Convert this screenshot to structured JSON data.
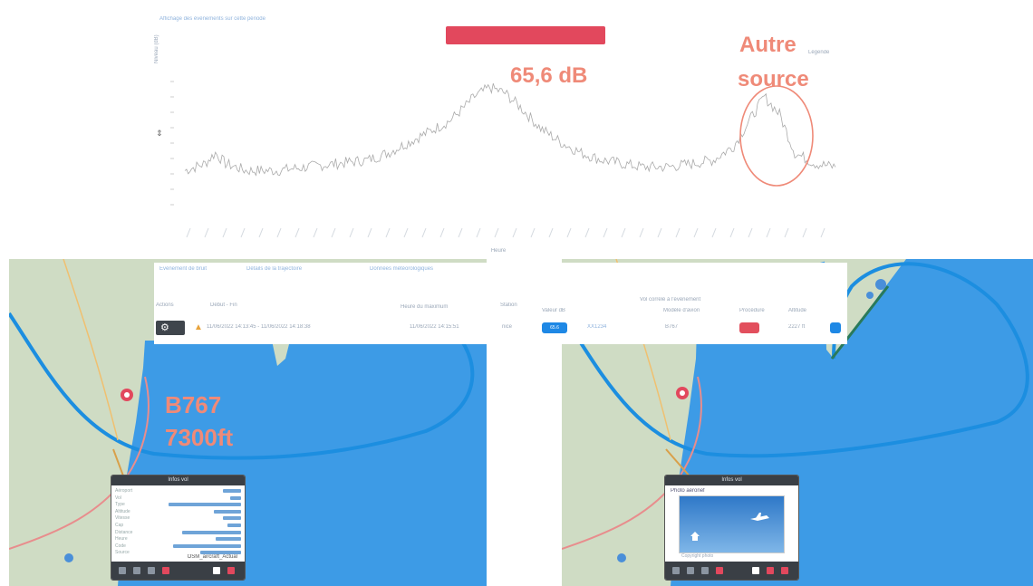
{
  "chart": {
    "top_link": "Affichage des évènements sur cette période",
    "red_banner": "",
    "y_axis_label": "Niveau (dB)",
    "annotation_level": "65,6 dB",
    "annotation_source": [
      "Autre",
      "source"
    ],
    "corner_text": "Légende",
    "x_axis_label": "Heure"
  },
  "chart_data": {
    "type": "line",
    "title": "",
    "ylabel": "",
    "xlabel": "",
    "peak_annotation": "65,6 dB",
    "highlight_annotation": "Autre source",
    "series": [
      {
        "color": "#aaaaaa",
        "points": [
          [
            0,
            42
          ],
          [
            4,
            44
          ],
          [
            6,
            47
          ],
          [
            8,
            44
          ],
          [
            12,
            42
          ],
          [
            18,
            42
          ],
          [
            24,
            43
          ],
          [
            30,
            44
          ],
          [
            36,
            45
          ],
          [
            40,
            47
          ],
          [
            44,
            50
          ],
          [
            48,
            53
          ],
          [
            52,
            56
          ],
          [
            55,
            60
          ],
          [
            57,
            63
          ],
          [
            60,
            65.6
          ],
          [
            63,
            64
          ],
          [
            66,
            60
          ],
          [
            70,
            54
          ],
          [
            74,
            50
          ],
          [
            78,
            47
          ],
          [
            82,
            45
          ],
          [
            86,
            44
          ],
          [
            90,
            43
          ],
          [
            95,
            43
          ],
          [
            100,
            44
          ],
          [
            104,
            45
          ],
          [
            108,
            49
          ],
          [
            111,
            56
          ],
          [
            114,
            63
          ],
          [
            117,
            58
          ],
          [
            120,
            47
          ],
          [
            124,
            44
          ],
          [
            128,
            43
          ]
        ]
      }
    ]
  },
  "tabs": {
    "items": [
      "Évènement de bruit",
      "Détails de la trajectoire",
      "Données météorologiques"
    ]
  },
  "table": {
    "headers": [
      "Actions",
      "Début - Fin",
      "Heure du maximum",
      "Station",
      "Valeur dB",
      "Vol corrélé à l'évènement",
      "Modèle d'avion",
      "Procédure",
      "Altitude"
    ],
    "row": {
      "period": "11/06/2022 14:13:45 - 11/06/2022 14:18:38",
      "max_time": "11/06/2022 14:15:51",
      "station": "nice",
      "db_value": "65.6",
      "flight": "XX1234",
      "model": "B767",
      "procedure": "",
      "altitude": "2227 ft"
    }
  },
  "left_map": {
    "annotation": [
      "B767",
      "7300ft"
    ],
    "popup_title": "Infos vol",
    "popup_rows": [
      "Aéroport",
      "Vol",
      "Type",
      "Altitude",
      "Vitesse",
      "Cap",
      "Distance",
      "Heure",
      "Code",
      "Source"
    ],
    "popup_values": [
      0.2,
      0.12,
      0.8,
      0.3,
      0.2,
      0.15,
      0.65,
      0.28,
      0.75,
      0.45
    ],
    "footer_label": "OSM_aircraft_Actual"
  },
  "right_map": {
    "popup_title": "Infos vol",
    "popup_caption": "Photo aéronef",
    "photo_credit": "Copyright photo"
  },
  "colors": {
    "sea": "#3d9be6",
    "track": "#1c8ee0",
    "land": "#cfdcc4",
    "annotation": "#ef8a78",
    "banner": "#e2485d",
    "badge_blue": "#1e88e5",
    "badge_red": "#e24f5d"
  }
}
